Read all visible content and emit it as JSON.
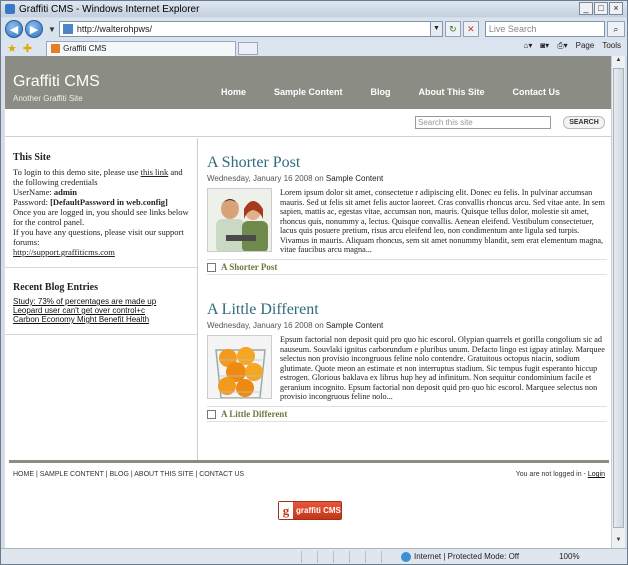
{
  "window": {
    "title": "Graffiti CMS - Windows Internet Explorer",
    "minimize": "_",
    "maximize": "□",
    "close": "×"
  },
  "browser": {
    "address": "http://walterohpws/",
    "search_placeholder": "Live Search",
    "tab_title": "Graffiti CMS",
    "cmd_page": "Page",
    "cmd_tools": "Tools",
    "back": "◀",
    "forward": "▶"
  },
  "site": {
    "title": "Graffiti CMS",
    "tagline": "Another Graffiti Site",
    "nav": [
      "Home",
      "Sample Content",
      "Blog",
      "About This Site",
      "Contact Us"
    ],
    "search_placeholder": "Search this site",
    "search_button": "SEARCH"
  },
  "sidebar": {
    "this_site": {
      "heading": "This Site",
      "line1": "To login to this demo site, please use ",
      "line1_link": "this link",
      "line2": " and the following credentials",
      "username_label": "UserName: ",
      "username": "admin",
      "password_label": "Password: ",
      "password": "[DefaultPassword in web.config]",
      "line3": "Once you are logged in, you should see links below for the control panel.",
      "line4": "If you have any questions, please visit our support forums:",
      "support_link": "http://support.graffiticms.com"
    },
    "recent": {
      "heading": "Recent Blog Entries",
      "items": [
        "Study: 73% of percentages are made up",
        "Leopard user can't get over control+c",
        "Carbon Economy Might Benefit Health"
      ]
    }
  },
  "posts": [
    {
      "title": "A Shorter Post",
      "date": "Wednesday, January 16 2008 on ",
      "category": "Sample Content",
      "body": "Lorem ipsum dolor sit amet, consectetue r adipiscing elit. Donec eu felis. In pulvinar accumsan mauris. Sed ut felis sit amet felis auctor laoreet. Cras convallis rhoncus arcu. Sed vitae ante. In sem sapien, mattis ac, egestas vitae, accumsan non, mauris. Quisque tellus dolor, molestie sit amet, rhoncus quis, nonummy a, lectus. Quisque convallis. Aenean eleifend. Vestibulum consectetuer, lacus quis posuere pretium, risus arcu eleifend leo, non condimentum ante ligula sed turpis. Vivamus in mauris. Aliquam rhoncus, sem sit amet nonummy blandit, sem erat elementum magna, vitae faucibus arcu magna...",
      "link": "A Shorter Post"
    },
    {
      "title": "A Little Different",
      "date": "Wednesday, January 16 2008 on ",
      "category": "Sample Content",
      "body": "Epsum factorial non deposit quid pro quo hic escorol. Olypian quarrels et gorilla congolium sic ad nauseum. Souvlaki ignitus carborundum e pluribus unum. Defacto lingo est igpay atinlay. Marquee selectus non provisio incongruous feline nolo contendre. Gratuitous octopus niacin, sodium glutimate. Quote meon an estimate et non interruptus stadium. Sic tempus fugit esperanto hiccup estrogen. Glorious baklava ex librus hup hey ad infinitum. Non sequitur condominium facile et geranium incognito. Epsum factorial non deposit quid pro quo hic escorol. Marquee selectus non provisio incongruous feline nolo...",
      "link": "A Little Different"
    }
  ],
  "footer": {
    "nav": "HOME | SAMPLE CONTENT | BLOG | ABOUT THIS SITE | CONTACT US",
    "login_text": "You are not logged in - ",
    "login_link": "Login",
    "logo_text": "graffiti CMS",
    "logo_letter": "g"
  },
  "status": {
    "zone": "Internet | Protected Mode: Off",
    "zoom": "100%"
  }
}
